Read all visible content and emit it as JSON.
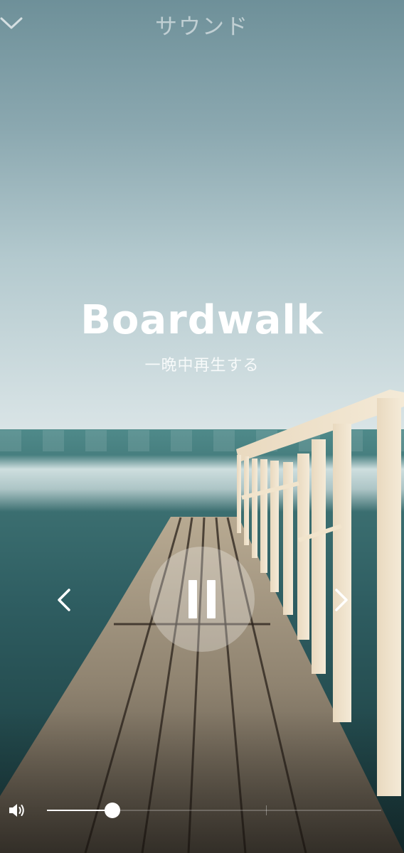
{
  "header": {
    "title": "サウンド",
    "collapse_icon": "chevron-down-icon"
  },
  "track": {
    "title": "Boardwalk",
    "subtitle": "一晩中再生する"
  },
  "controls": {
    "prev_icon": "chevron-left-icon",
    "play_state_icon": "pause-icon",
    "next_icon": "chevron-right-icon"
  },
  "volume": {
    "icon": "speaker-icon",
    "level": 0.195,
    "marker": 0.655
  },
  "colors": {
    "overlay_text": "#ffffff",
    "header_text": "#c8d6d9"
  }
}
